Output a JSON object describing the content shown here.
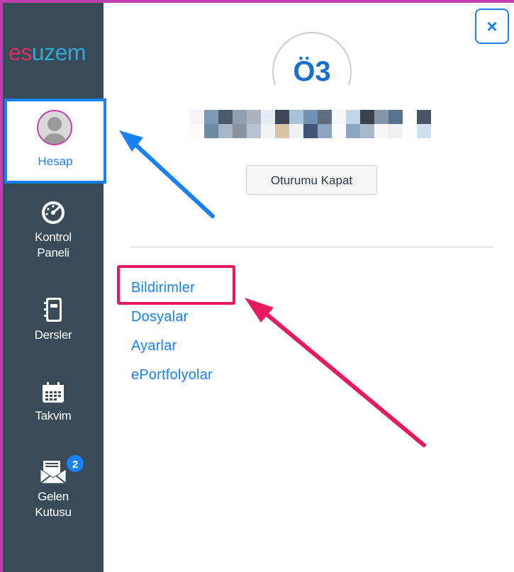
{
  "logo": {
    "part1": "es",
    "part2": "uzem"
  },
  "nav": {
    "account": "Hesap",
    "dashboard_line1": "Kontrol",
    "dashboard_line2": "Paneli",
    "courses": "Dersler",
    "calendar": "Takvim",
    "inbox_line1": "Gelen",
    "inbox_line2": "Kutusu",
    "inbox_badge": "2"
  },
  "tray": {
    "close_icon": "×",
    "initials": "Ö3",
    "logout_label": "Oturumu Kapat",
    "links": [
      "Bildirimler",
      "Dosyalar",
      "Ayarlar",
      "ePortfolyolar"
    ]
  },
  "colors": {
    "nav_bg": "#394b58",
    "accent": "#1a80f5",
    "highlight_blue": "#1a80f5",
    "highlight_pink": "#e8195e"
  }
}
